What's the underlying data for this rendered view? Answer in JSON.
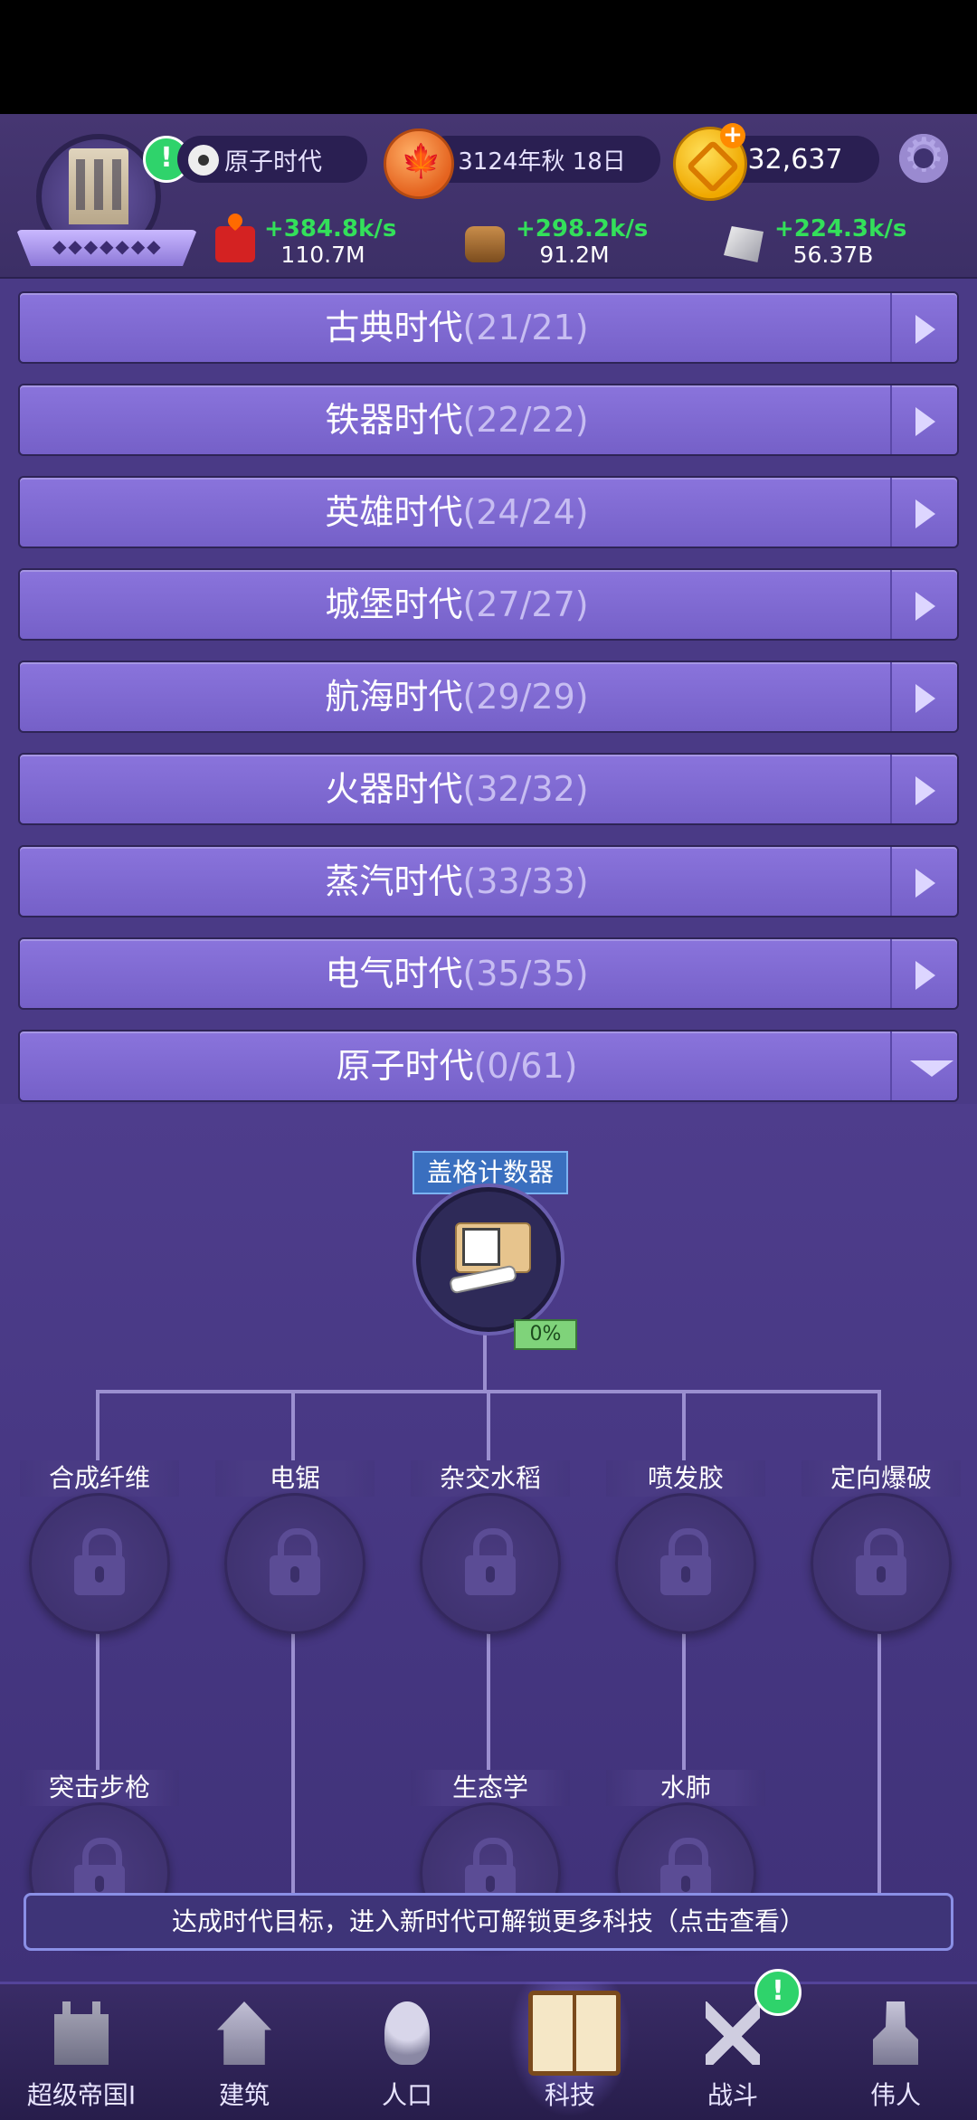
{
  "header": {
    "era_name": "原子时代",
    "date": "3124年秋 18日",
    "gems": "32,637",
    "alert_mark": "!",
    "resources": [
      {
        "icon": "fire-icon",
        "rate": "+384.8k/s",
        "amount": "110.7M"
      },
      {
        "icon": "wood-icon",
        "rate": "+298.2k/s",
        "amount": "91.2M"
      },
      {
        "icon": "stone-icon",
        "rate": "+224.3k/s",
        "amount": "56.37B"
      }
    ]
  },
  "eras": [
    {
      "name": "古典时代",
      "count": "(21/21)",
      "expanded": false
    },
    {
      "name": "铁器时代",
      "count": "(22/22)",
      "expanded": false
    },
    {
      "name": "英雄时代",
      "count": "(24/24)",
      "expanded": false
    },
    {
      "name": "城堡时代",
      "count": "(27/27)",
      "expanded": false
    },
    {
      "name": "航海时代",
      "count": "(29/29)",
      "expanded": false
    },
    {
      "name": "火器时代",
      "count": "(32/32)",
      "expanded": false
    },
    {
      "name": "蒸汽时代",
      "count": "(33/33)",
      "expanded": false
    },
    {
      "name": "电气时代",
      "count": "(35/35)",
      "expanded": false
    },
    {
      "name": "原子时代",
      "count": "(0/61)",
      "expanded": true
    }
  ],
  "tech_tree": {
    "root": {
      "name": "盖格计数器",
      "progress": "0%"
    },
    "tier1": [
      "合成纤维",
      "电锯",
      "杂交水稻",
      "喷发胶",
      "定向爆破"
    ],
    "tier2": [
      "突击步枪",
      "生态学",
      "水肺"
    ]
  },
  "banner": "达成时代目标，进入新时代可解锁更多科技（点击查看）",
  "nav": {
    "items": [
      {
        "label": "超级帝国I",
        "icon": "castle-icon"
      },
      {
        "label": "建筑",
        "icon": "house-icon"
      },
      {
        "label": "人口",
        "icon": "person-icon"
      },
      {
        "label": "科技",
        "icon": "book-icon",
        "active": true
      },
      {
        "label": "战斗",
        "icon": "swords-icon",
        "alert": "!"
      },
      {
        "label": "伟人",
        "icon": "greatman-icon"
      }
    ]
  }
}
